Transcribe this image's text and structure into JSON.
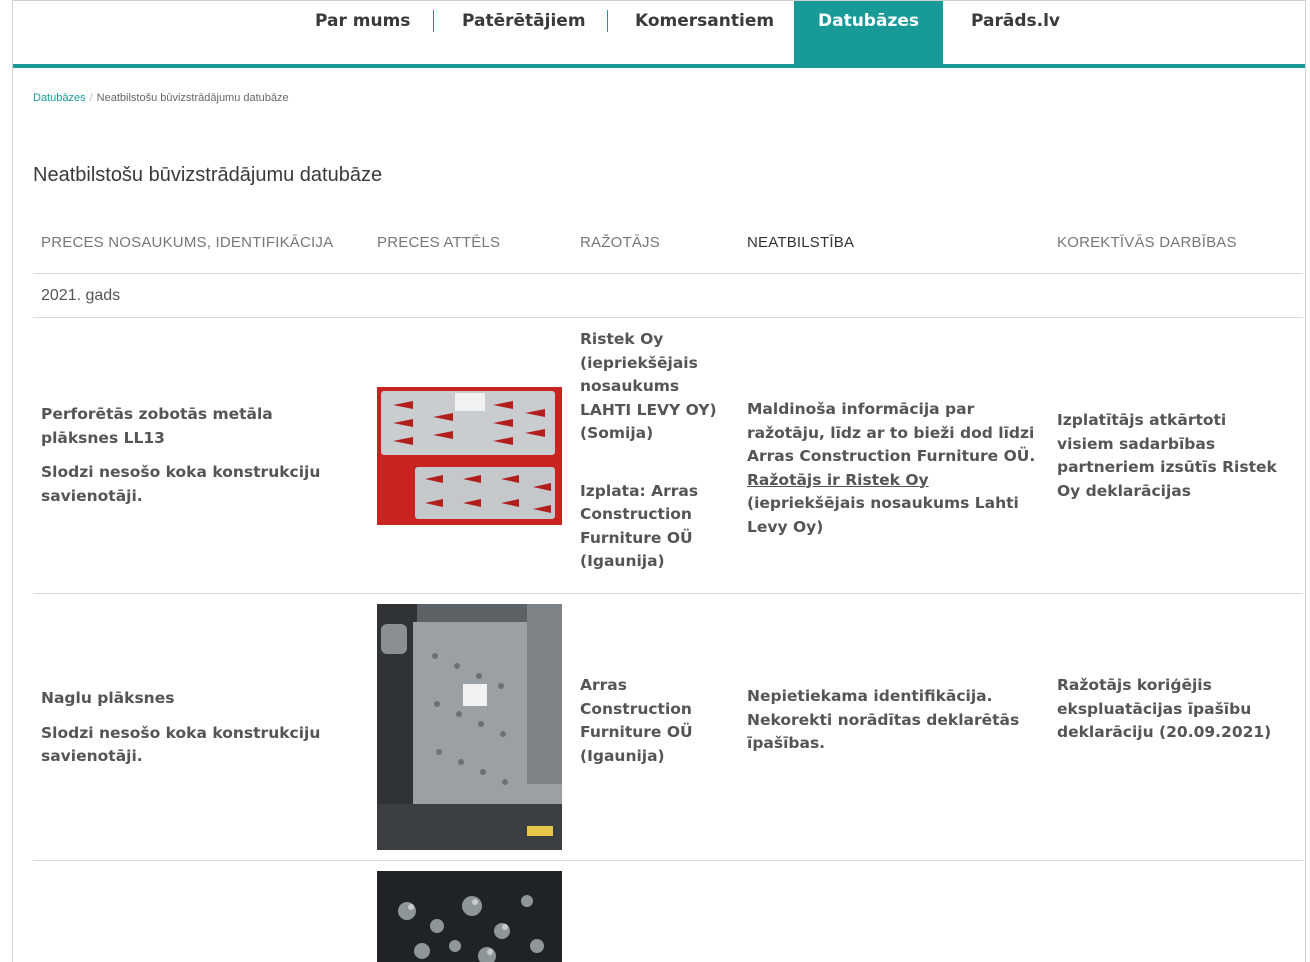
{
  "nav": {
    "items": [
      "Par mums",
      "Patērētājiem",
      "Komersantiem",
      "Datubāzes",
      "Parāds.lv"
    ],
    "active": "Datubāzes"
  },
  "breadcrumb": {
    "root": "Datubāzes",
    "separator": "/",
    "current": "Neatbilstošu būvizstrādājumu datubāze"
  },
  "page_title": "Neatbilstošu būvizstrādājumu datubāze",
  "table": {
    "headers": {
      "product": "PRECES NOSAUKUMS, IDENTIFIKĀCIJA",
      "image": "PRECES ATTĒLS",
      "manufacturer": "RAŽOTĀJS",
      "nonconformity": "NEATBILSTĪBA",
      "actions": "KOREKTĪVĀS DARBĪBAS"
    },
    "year_group": "2021. gads",
    "rows": [
      {
        "product_name": "Perforētās zobotās metāla plāksnes LL13",
        "product_type": "Slodzi nesošo koka konstrukciju savienotāji.",
        "manufacturer": "Ristek Oy (iepriekšējais nosaukums LAHTI LEVY OY) (Somija)",
        "distributor": "Izplata: Arras Construction Furniture OÜ (Igaunija)",
        "nonconformity_pre": "Maldinoša informācija par ražotāju, līdz ar to bieži dod līdzi Arras Construction Furniture OÜ.",
        "nonconformity_link": "Ražotājs ir Ristek Oy",
        "nonconformity_post": "(iepriekšējais nosaukums Lahti Levy Oy)",
        "actions": "Izplatītājs atkārtoti visiem sadarbības partneriem izsūtīs Ristek Oy deklarācijas"
      },
      {
        "product_name": "Naglu plāksnes",
        "product_type": "Slodzi nesošo koka konstrukciju savienotāji.",
        "manufacturer": "Arras Construction Furniture OÜ (Igaunija)",
        "nonconformity": "Nepietiekama identifikācija. Nekorekti norādītas deklarētās īpašības.",
        "actions": "Ražotājs koriģējis ekspluatācijas īpašību deklarāciju (20.09.2021)"
      }
    ]
  },
  "colors": {
    "accent": "#189a99"
  }
}
